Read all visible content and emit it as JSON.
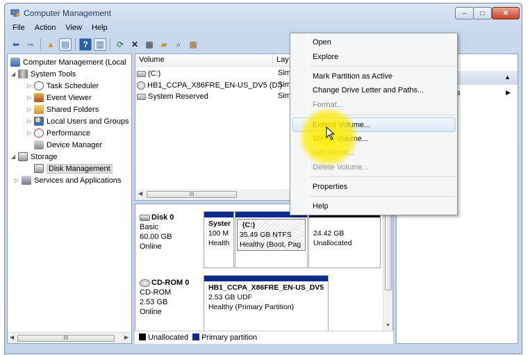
{
  "window": {
    "title": "Computer Management",
    "controls": {
      "minimize": "–",
      "maximize": "□",
      "close": "✕"
    }
  },
  "menubar": [
    "File",
    "Action",
    "View",
    "Help"
  ],
  "toolbar_icons": [
    "back-icon",
    "forward-icon",
    "up-folder-icon",
    "show-hide-tree-icon",
    "help-icon",
    "properties-pane-icon",
    "refresh-icon",
    "delete-icon",
    "properties-icon",
    "open-icon",
    "search-icon",
    "export-icon"
  ],
  "tree": {
    "root": "Computer Management (Local",
    "system_tools": "System Tools",
    "task_scheduler": "Task Scheduler",
    "event_viewer": "Event Viewer",
    "shared_folders": "Shared Folders",
    "local_users": "Local Users and Groups",
    "performance": "Performance",
    "device_manager": "Device Manager",
    "storage": "Storage",
    "disk_management": "Disk Management",
    "services": "Services and Applications"
  },
  "volumes": {
    "headers": {
      "volume": "Volume",
      "layout": "Lay"
    },
    "rows": [
      {
        "name": "(C:)",
        "layout": "Sim"
      },
      {
        "name": "HB1_CCPA_X86FRE_EN-US_DV5 (D:)",
        "layout": "Sim"
      },
      {
        "name": "System Reserved",
        "layout": "Sim"
      }
    ],
    "scroll_thumb": "III"
  },
  "disks": {
    "disk0": {
      "name": "Disk 0",
      "type": "Basic",
      "size": "60.00 GB",
      "status": "Online",
      "partitions": [
        {
          "name": "Syster",
          "size": "100 M",
          "status": "Health"
        },
        {
          "name": "(C:)",
          "size": "35.49 GB NTFS",
          "status": "Healthy (Boot, Pag"
        },
        {
          "name": "",
          "size": "24.42 GB",
          "status": "Unallocated"
        }
      ]
    },
    "cdrom0": {
      "name": "CD-ROM 0",
      "type": "CD-ROM",
      "size": "2.53 GB",
      "status": "Online",
      "partition": {
        "name": "HB1_CCPA_X86FRE_EN-US_DV5",
        "size": "2.53 GB UDF",
        "status": "Healthy (Primary Partition)"
      }
    }
  },
  "legend": {
    "unallocated": "Unallocated",
    "primary": "Primary partition"
  },
  "actions_pane": {
    "header": "nt",
    "item": "ns"
  },
  "left_scroll_thumb": "III",
  "context_menu": {
    "open": "Open",
    "explore": "Explore",
    "mark_active": "Mark Partition as Active",
    "change_letter": "Change Drive Letter and Paths...",
    "format": "Format...",
    "extend": "Extend Volume...",
    "shrink": "Shrink Volume...",
    "add_mirror": "Add Mirror...",
    "delete": "Delete Volume...",
    "properties": "Properties",
    "help": "Help"
  },
  "colors": {
    "primary_partition": "#0a2a8c",
    "unallocated": "#000000",
    "highlight": "#ffec00"
  }
}
